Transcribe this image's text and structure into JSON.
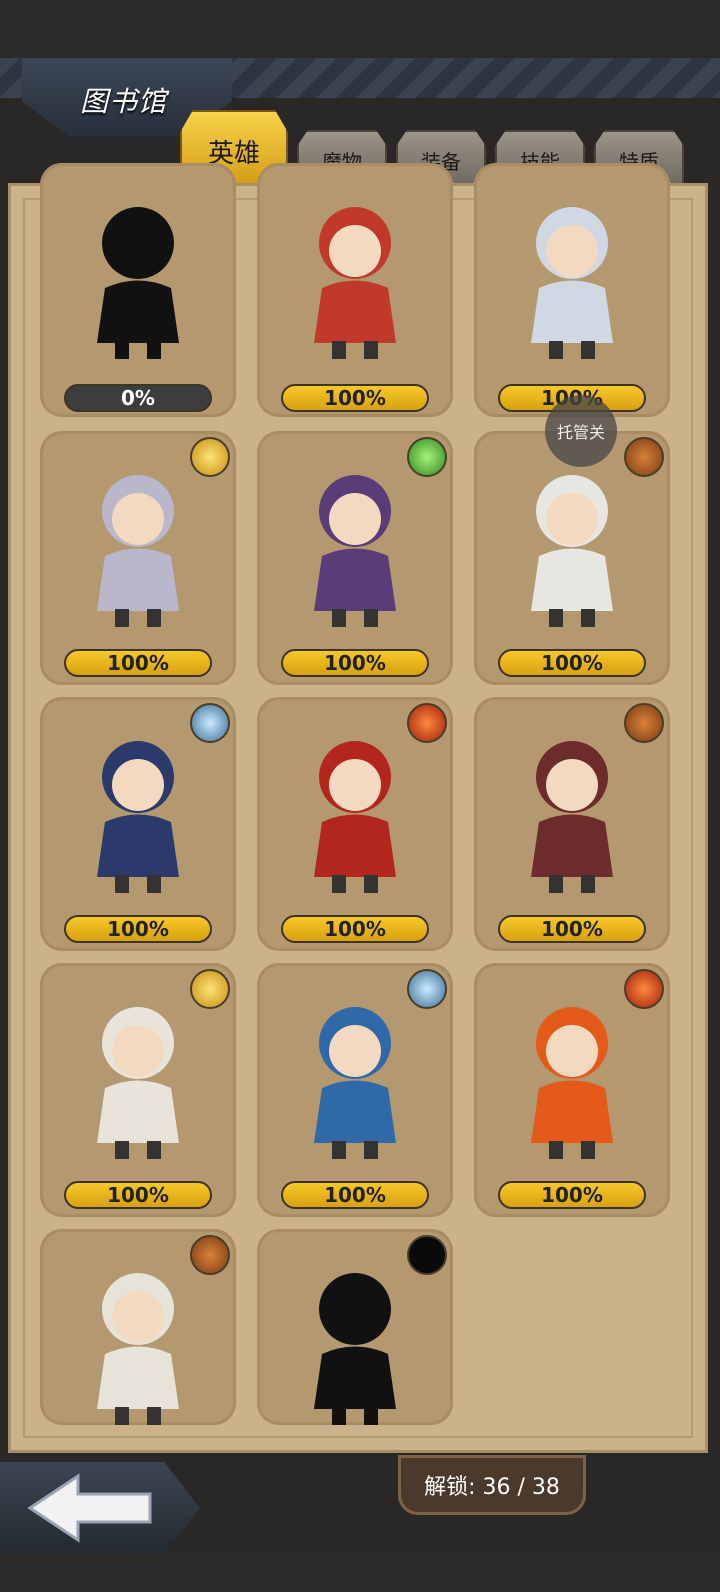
{
  "header": {
    "title": "图书馆"
  },
  "tabs": [
    {
      "label": "英雄",
      "active": true
    },
    {
      "label": "魔物",
      "active": false
    },
    {
      "label": "装备",
      "active": false
    },
    {
      "label": "技能",
      "active": false
    },
    {
      "label": "特质",
      "active": false
    }
  ],
  "cards": [
    {
      "progress": "0%",
      "locked": true,
      "badge": null,
      "color": "#111111"
    },
    {
      "progress": "100%",
      "badge": null,
      "color": "#c0392b"
    },
    {
      "progress": "100%",
      "badge": null,
      "color": "#cfd8e3"
    },
    {
      "progress": "100%",
      "badge": "gold-sun-badge-icon",
      "color": "#b9b7c9"
    },
    {
      "progress": "100%",
      "badge": "green-gem-badge-icon",
      "color": "#5a3c78"
    },
    {
      "progress": "100%",
      "badge": "brown-web-badge-icon",
      "color": "#e8e6e0"
    },
    {
      "progress": "100%",
      "badge": "blue-flower-badge-icon",
      "color": "#2b3a6b"
    },
    {
      "progress": "100%",
      "badge": "red-flame-badge-icon",
      "color": "#b3261e"
    },
    {
      "progress": "100%",
      "badge": "brown-web-badge-icon",
      "color": "#6d2c2c"
    },
    {
      "progress": "100%",
      "badge": "gold-sun-badge-icon",
      "color": "#e9e4db"
    },
    {
      "progress": "100%",
      "badge": "blue-flower-badge-icon",
      "color": "#2f69a8"
    },
    {
      "progress": "100%",
      "badge": "red-flame-badge-icon",
      "color": "#e45a1b"
    },
    {
      "progress": "",
      "badge": "brown-web-badge-icon",
      "color": "#e6e3d8"
    },
    {
      "progress": "",
      "locked": true,
      "badge": "black-badge-icon",
      "color": "#111111"
    }
  ],
  "overlay": {
    "toggle_label": "托管关"
  },
  "footer": {
    "unlock_text": "解锁: 36 / 38"
  },
  "colors": {
    "gold": "#e7b21a",
    "panel": "#cbb28a",
    "card": "#b49870"
  }
}
